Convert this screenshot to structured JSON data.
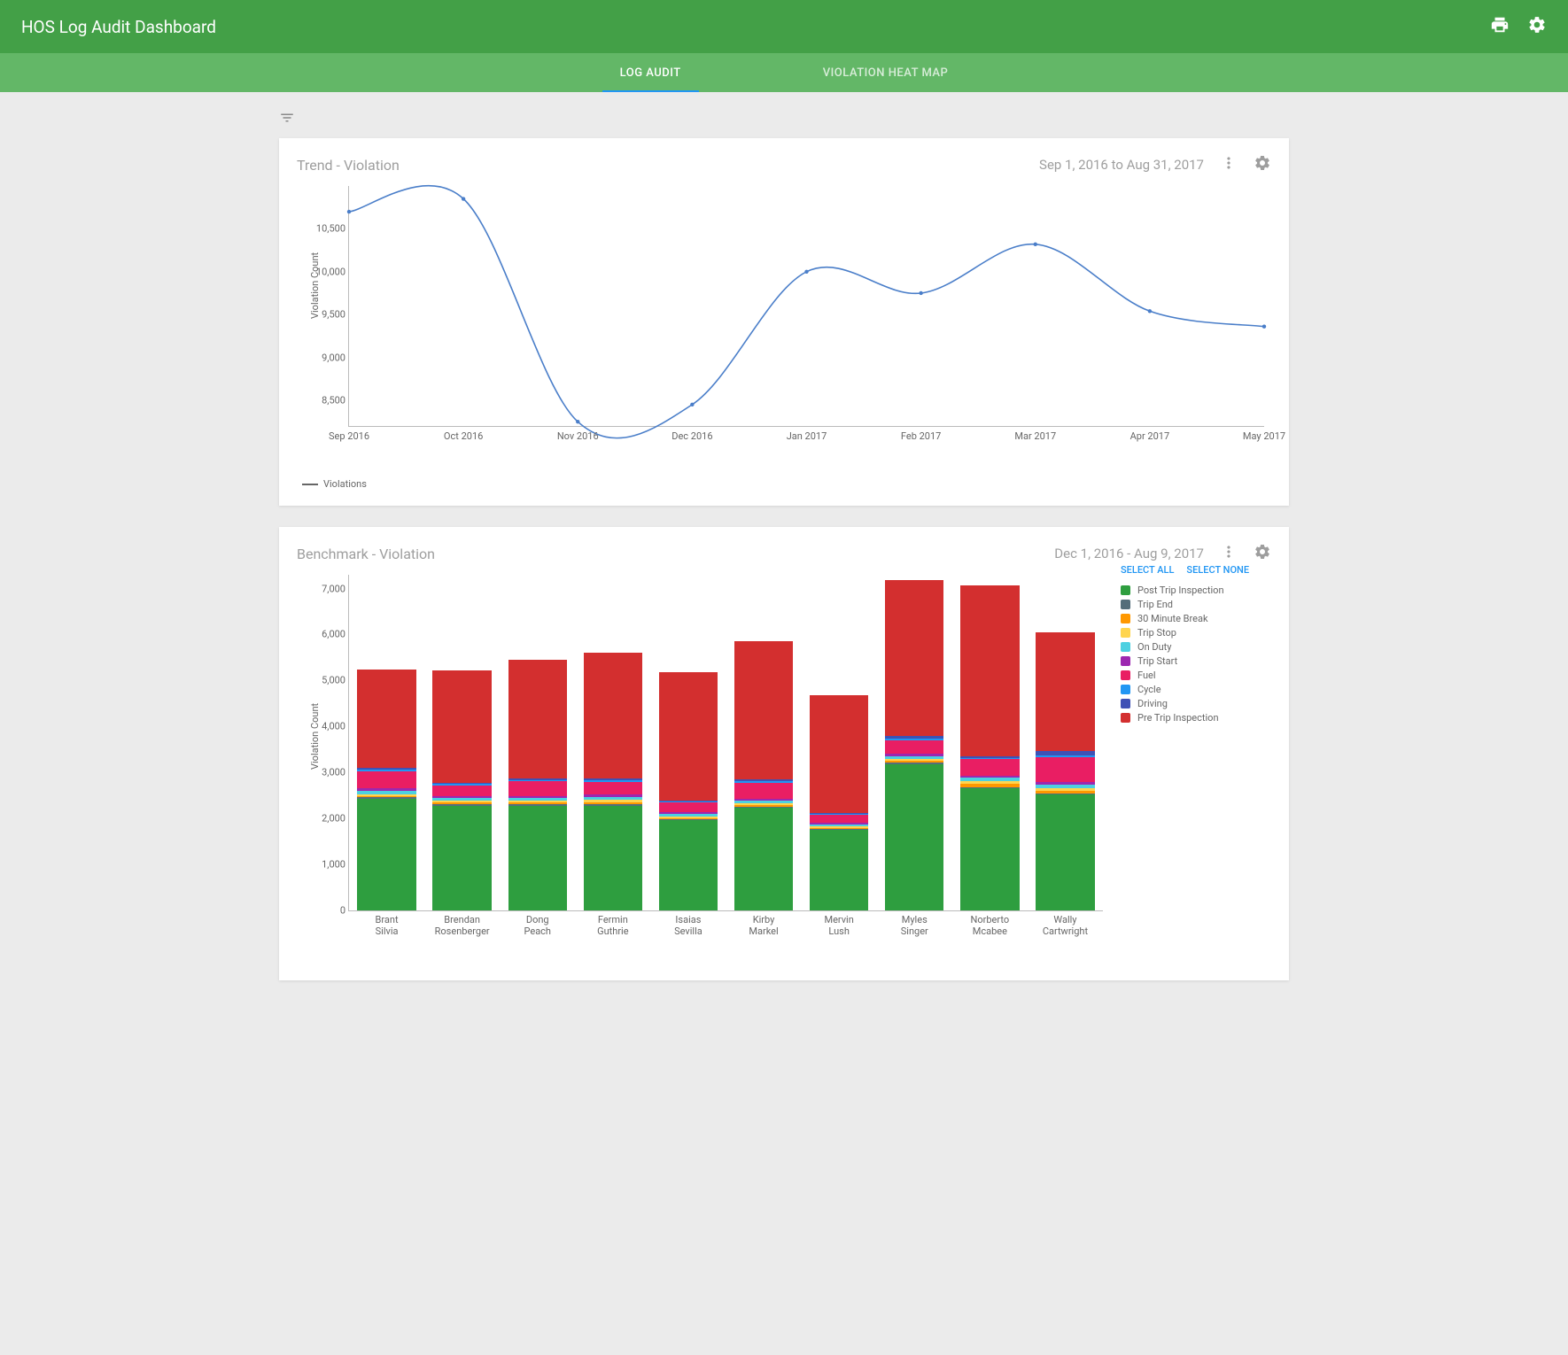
{
  "header": {
    "title": "HOS Log Audit Dashboard"
  },
  "tabs": {
    "log_audit": "LOG AUDIT",
    "heat_map": "VIOLATION HEAT MAP"
  },
  "trend": {
    "title": "Trend - Violation",
    "date_range": "Sep 1, 2016 to Aug 31, 2017",
    "y_axis_title": "Violation Count",
    "legend_label": "Violations"
  },
  "benchmark": {
    "title": "Benchmark - Violation",
    "date_range": "Dec 1, 2016 - Aug 9, 2017",
    "y_axis_title": "Violation Count",
    "select_all": "SELECT ALL",
    "select_none": "SELECT NONE"
  },
  "chart_data": [
    {
      "type": "line",
      "title": "Trend - Violation",
      "xlabel": "",
      "ylabel": "Violation Count",
      "ylim": [
        8200,
        11000
      ],
      "x": [
        "Sep 2016",
        "Oct 2016",
        "Nov 2016",
        "Dec 2016",
        "Jan 2017",
        "Feb 2017",
        "Mar 2017",
        "Apr 2017",
        "May 2017"
      ],
      "y_ticks": [
        8500,
        9000,
        9500,
        10000,
        10500
      ],
      "series": [
        {
          "name": "Violations",
          "color": "#4a7ec9",
          "values": [
            10700,
            10850,
            8250,
            8450,
            10000,
            9750,
            10320,
            9540,
            9360
          ]
        }
      ]
    },
    {
      "type": "bar",
      "subtype": "stacked",
      "title": "Benchmark - Violation",
      "xlabel": "",
      "ylabel": "Violation Count",
      "ylim": [
        0,
        7300
      ],
      "y_ticks": [
        0,
        1000,
        2000,
        3000,
        4000,
        5000,
        6000,
        7000
      ],
      "categories": [
        "Brant Silvia",
        "Brendan Rosenberger",
        "Dong Peach",
        "Fermin Guthrie",
        "Isaias Sevilla",
        "Kirby Markel",
        "Mervin Lush",
        "Myles Singer",
        "Norberto Mcabee",
        "Wally Cartwright"
      ],
      "legend_order": [
        "Post Trip Inspection",
        "Trip End",
        "30 Minute Break",
        "Trip Stop",
        "On Duty",
        "Trip Start",
        "Fuel",
        "Cycle",
        "Driving",
        "Pre Trip Inspection"
      ],
      "colors": {
        "Post Trip Inspection": "#2e9e3f",
        "Trip End": "#546e7a",
        "30 Minute Break": "#ff9800",
        "Trip Stop": "#ffd54f",
        "On Duty": "#4dd0e1",
        "Trip Start": "#9c27b0",
        "Fuel": "#e91e63",
        "Cycle": "#2196f3",
        "Driving": "#3f51b5",
        "Pre Trip Inspection": "#d32f2f"
      },
      "series": [
        {
          "name": "Post Trip Inspection",
          "values": [
            2430,
            2280,
            2280,
            2280,
            1960,
            2230,
            1750,
            3180,
            2650,
            2520
          ]
        },
        {
          "name": "Trip End",
          "values": [
            30,
            30,
            30,
            30,
            30,
            30,
            20,
            30,
            30,
            30
          ]
        },
        {
          "name": "30 Minute Break",
          "values": [
            30,
            40,
            40,
            40,
            20,
            40,
            20,
            40,
            80,
            50
          ]
        },
        {
          "name": "Trip Stop",
          "values": [
            40,
            30,
            40,
            60,
            30,
            30,
            40,
            40,
            60,
            60
          ]
        },
        {
          "name": "On Duty",
          "values": [
            80,
            60,
            60,
            60,
            60,
            60,
            40,
            70,
            70,
            80
          ]
        },
        {
          "name": "Trip Start",
          "values": [
            40,
            40,
            40,
            50,
            30,
            30,
            30,
            60,
            40,
            60
          ]
        },
        {
          "name": "Fuel",
          "values": [
            380,
            240,
            320,
            280,
            220,
            360,
            180,
            280,
            360,
            540
          ]
        },
        {
          "name": "Cycle",
          "values": [
            40,
            30,
            30,
            30,
            20,
            30,
            20,
            30,
            30,
            40
          ]
        },
        {
          "name": "Driving",
          "values": [
            40,
            30,
            40,
            40,
            20,
            40,
            20,
            60,
            40,
            80
          ]
        },
        {
          "name": "Pre Trip Inspection",
          "values": [
            2140,
            2450,
            2580,
            2740,
            2800,
            3000,
            2560,
            3400,
            3720,
            2590
          ]
        }
      ]
    }
  ]
}
